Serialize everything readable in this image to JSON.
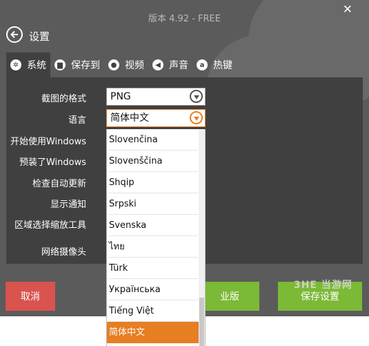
{
  "window": {
    "title": "版本 4.92 - FREE",
    "close_glyph": "✕"
  },
  "header": {
    "back_label": "设置"
  },
  "tabs": [
    {
      "label": "系统",
      "icon": "gear-icon"
    },
    {
      "label": "保存到",
      "icon": "folder-icon"
    },
    {
      "label": "视频",
      "icon": "record-icon"
    },
    {
      "label": "声音",
      "icon": "speaker-icon"
    },
    {
      "label": "热键",
      "icon": "hotkey-icon"
    }
  ],
  "settings": {
    "format_label": "截图的格式",
    "format_value": "PNG",
    "language_label": "语言",
    "language_value": "简体中文",
    "start_windows_label": "开始使用Windows",
    "preinstalled_label": "预装了Windows",
    "auto_update_label": "检查自动更新",
    "notifications_label": "显示通知",
    "zoom_tool_label": "区域选择缩放工具",
    "webcam_label": "网络摄像头"
  },
  "language_options": [
    "Slovenčina",
    "Slovenščina",
    "Shqip",
    "Srpski",
    "Svenska",
    "ไทย",
    "Türk",
    "Українська",
    "Tiếng Việt",
    "简体中文"
  ],
  "selected_language_index": 9,
  "buttons": {
    "cancel": "取消",
    "pro": "业版",
    "save": "保存设置"
  },
  "watermark": "3HE 当游网",
  "colors": {
    "accent": "#e67e22",
    "cancel": "#d9534f",
    "save": "#7cb936",
    "panel": "#404040"
  }
}
